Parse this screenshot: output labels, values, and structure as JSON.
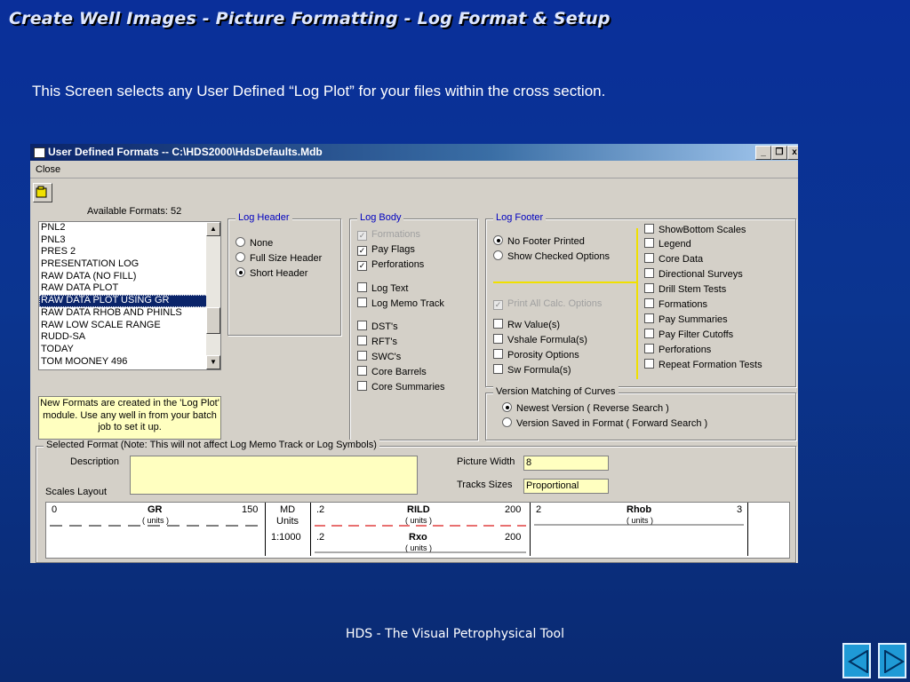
{
  "slide": {
    "title": "Create Well Images - Picture Formatting - Log Format & Setup",
    "subtitle": "This Screen selects any User Defined “Log Plot” for your files within the cross section.",
    "footer": "HDS - The Visual Petrophysical Tool",
    "nav": {
      "prev_icon": "left-triangle-icon",
      "next_icon": "right-triangle-icon",
      "button_color": "#1f9ad6"
    }
  },
  "dialog": {
    "title": "User Defined Formats  --  C:\\HDS2000\\HdsDefaults.Mdb",
    "min": "_",
    "restore": "❐",
    "close": "x",
    "menu_close": "Close",
    "toolbar_icon": "open-folder-icon",
    "available_label": "Available Formats: 52",
    "formats": [
      "PNL2",
      "PNL3",
      "PRES 2",
      "PRESENTATION LOG",
      "RAW DATA (NO FILL)",
      "RAW DATA PLOT",
      "RAW DATA PLOT USING GR",
      "RAW DATA RHOB AND PHINLS",
      "RAW LOW SCALE RANGE",
      "RUDD-SA",
      "TODAY",
      "TOM MOONEY 496"
    ],
    "selected_format": "RAW DATA PLOT USING GR",
    "note": "New Formats are created in the 'Log Plot' module.  Use any well in from your batch job to set it up.",
    "log_header": {
      "label": "Log Header",
      "options": [
        "None",
        "Full Size Header",
        "Short Header"
      ],
      "selected": "Short Header"
    },
    "log_body": {
      "label": "Log Body",
      "items": [
        {
          "label": "Formations",
          "checked": true,
          "disabled": true
        },
        {
          "label": "Pay Flags",
          "checked": true,
          "disabled": false
        },
        {
          "label": "Perforations",
          "checked": true,
          "disabled": false
        },
        {
          "label": "Log Text",
          "checked": false,
          "disabled": false
        },
        {
          "label": "Log Memo Track",
          "checked": false,
          "disabled": false
        },
        {
          "label": "DST's",
          "checked": false,
          "disabled": false
        },
        {
          "label": "RFT's",
          "checked": false,
          "disabled": false
        },
        {
          "label": "SWC's",
          "checked": false,
          "disabled": false
        },
        {
          "label": "Core Barrels",
          "checked": false,
          "disabled": false
        },
        {
          "label": "Core Summaries",
          "checked": false,
          "disabled": false
        }
      ]
    },
    "log_footer": {
      "label": "Log Footer",
      "radios": [
        "No Footer Printed",
        "Show Checked Options"
      ],
      "selected": "No Footer Printed",
      "print_all": "Print All Calc. Options",
      "calc_items": [
        "Rw Value(s)",
        "Vshale Formula(s)",
        "Porosity Options",
        "Sw Formula(s)"
      ],
      "right_items": [
        "ShowBottom Scales",
        "Legend",
        "Core Data",
        "Directional Surveys",
        "Drill Stem Tests",
        "Formations",
        "Pay Summaries",
        "Pay Filter Cutoffs",
        "Perforations",
        "Repeat Formation Tests"
      ]
    },
    "version": {
      "label": "Version Matching of Curves",
      "options": [
        "Newest Version ( Reverse Search )",
        "Version Saved in Format ( Forward Search )"
      ],
      "selected": "Newest Version ( Reverse Search )"
    },
    "selected_format_frame": {
      "label": "Selected Format  (Note: This will not affect Log Memo Track or Log Symbols)",
      "description_label": "Description",
      "description_value": "",
      "picture_width_label": "Picture Width",
      "picture_width_value": "8",
      "tracks_sizes_label": "Tracks Sizes",
      "tracks_sizes_value": "Proportional",
      "scales_layout_label": "Scales Layout"
    },
    "scales": {
      "track1": {
        "min": "0",
        "curve": "GR",
        "units": "( units )",
        "max": "150"
      },
      "depth": {
        "line1": "MD",
        "line2": "Units",
        "scale": "1:1000"
      },
      "track2a": {
        "min": ".2",
        "curve": "RILD",
        "units": "( units )",
        "max": "200"
      },
      "track2b": {
        "min": ".2",
        "curve": "Rxo",
        "units": "( units )",
        "max": "200"
      },
      "track3": {
        "min": "2",
        "curve": "Rhob",
        "units": "( units )",
        "max": "3"
      }
    }
  }
}
